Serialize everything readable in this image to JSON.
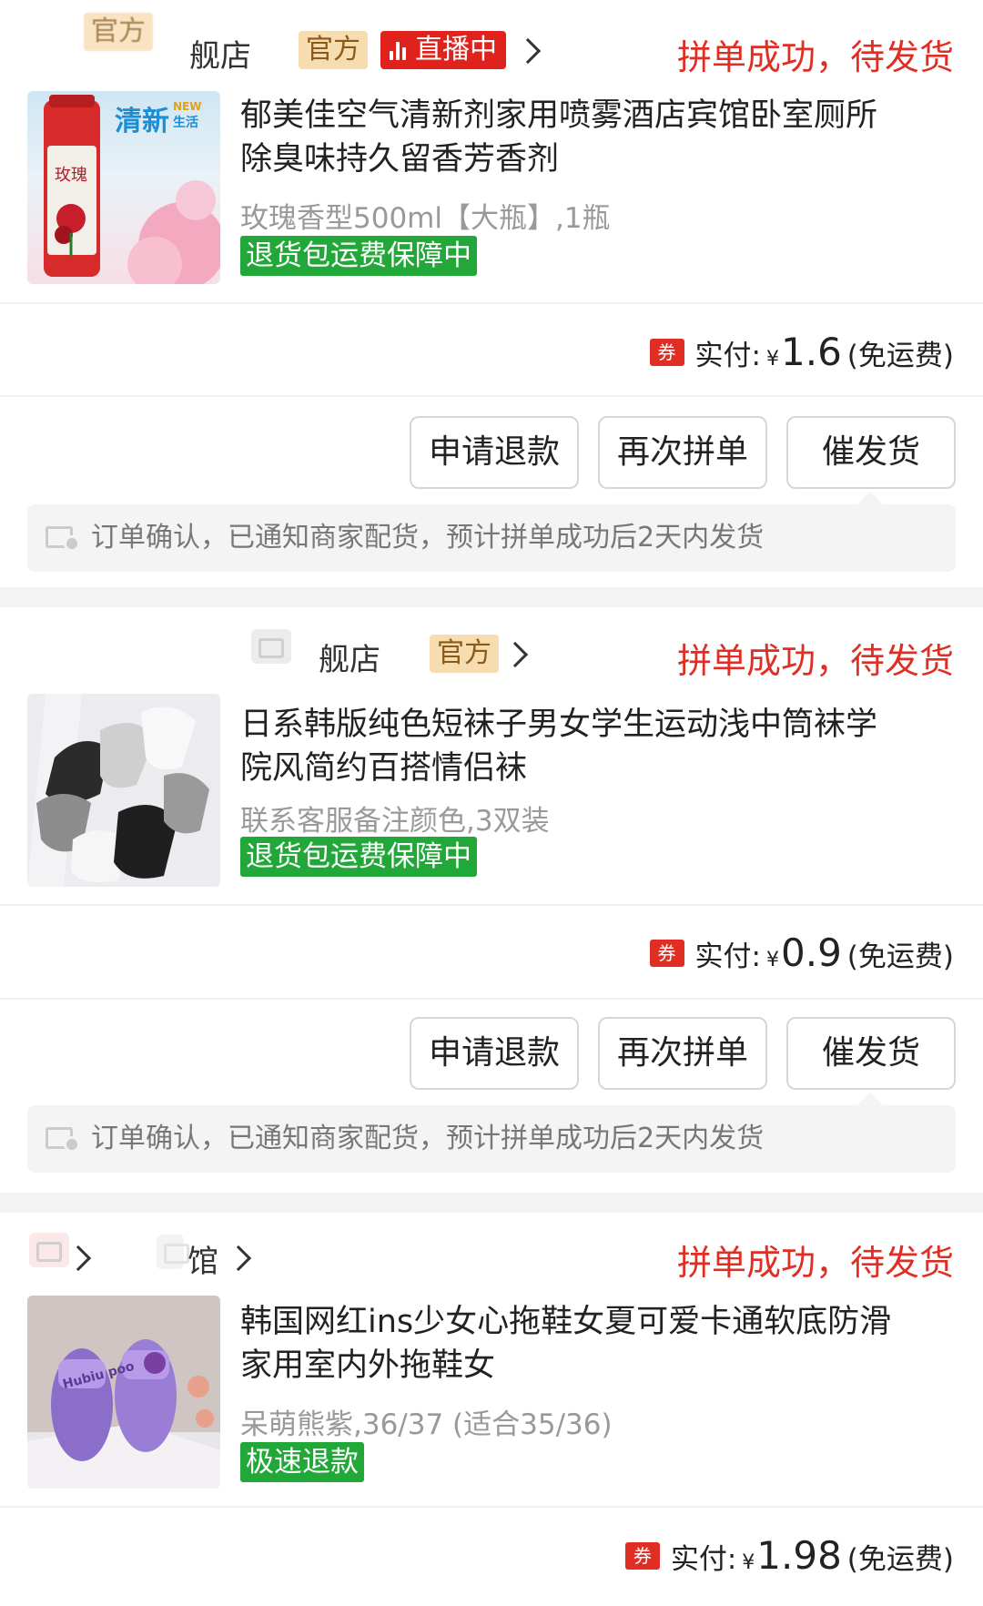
{
  "orders": [
    {
      "shop": {
        "name": "舰店",
        "blurred_prefix": "官方",
        "official_tag": "官方",
        "live_tag": "直播中"
      },
      "status": "拼单成功，待发货",
      "product": {
        "title": "郁美佳空气清新剂家用喷雾酒店宾馆卧室厕所除臭味持久留香芳香剂",
        "spec": "玫瑰香型500ml【大瓶】,1瓶",
        "guarantee": "退货包运费保障中",
        "thumb_text_main": "清新",
        "thumb_text_new": "NEW",
        "thumb_text_life": "生活",
        "thumb_text_rose": "玫瑰"
      },
      "payment": {
        "coupon": "券",
        "label": "实付",
        "colon": ":",
        "currency": "¥",
        "amount": "1.6",
        "shipping": "(免运费)"
      },
      "buttons": {
        "refund": "申请退款",
        "regroup": "再次拼单",
        "urge": "催发货"
      },
      "notice": "订单确认，已通知商家配货，预计拼单成功后2天内发货"
    },
    {
      "shop": {
        "name": "舰店",
        "official_tag": "官方"
      },
      "status": "拼单成功，待发货",
      "product": {
        "title": "日系韩版纯色短袜子男女学生运动浅中筒袜学院风简约百搭情侣袜",
        "spec": "联系客服备注颜色,3双装",
        "guarantee": "退货包运费保障中"
      },
      "payment": {
        "coupon": "券",
        "label": "实付",
        "colon": ":",
        "currency": "¥",
        "amount": "0.9",
        "shipping": "(免运费)"
      },
      "buttons": {
        "refund": "申请退款",
        "regroup": "再次拼单",
        "urge": "催发货"
      },
      "notice": "订单确认，已通知商家配货，预计拼单成功后2天内发货"
    },
    {
      "shop": {
        "name": "馆"
      },
      "status": "拼单成功，待发货",
      "product": {
        "title": "韩国网红ins少女心拖鞋女夏可爱卡通软底防滑家用室内外拖鞋女",
        "spec": "呆萌熊紫,36/37 (适合35/36)",
        "guarantee": "极速退款",
        "thumb_text": "Hubiu poo"
      },
      "payment": {
        "coupon": "券",
        "label": "实付",
        "colon": ":",
        "currency": "¥",
        "amount": "1.98",
        "shipping": "(免运费)"
      }
    }
  ],
  "colors": {
    "accent_red": "#e02e24",
    "guarantee_green": "#21a839",
    "official_tag_bg": "#f6dcae",
    "page_gap": "#f3f3f3"
  }
}
